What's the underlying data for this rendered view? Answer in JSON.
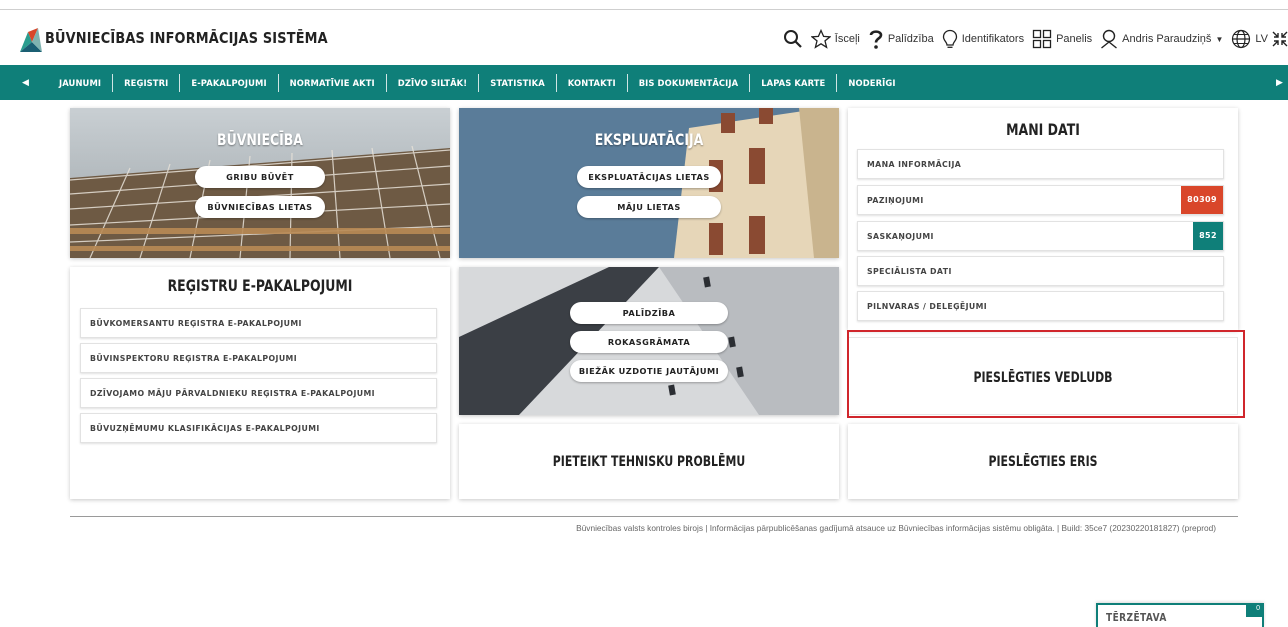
{
  "header": {
    "site_title": "BŪVNIECĪBAS INFORMĀCIJAS SISTĒMA",
    "tools": {
      "shortcuts": "Īsceļi",
      "help": "Palīdzība",
      "identifiers": "Identifikators",
      "panel": "Panelis",
      "user": "Andris Paraudziņš",
      "language": "LV"
    }
  },
  "nav": {
    "items": [
      "JAUNUMI",
      "REĢISTRI",
      "E-PAKALPOJUMI",
      "NORMATĪVIE AKTI",
      "DZĪVO SILTĀK!",
      "STATISTIKA",
      "KONTAKTI",
      "BIS DOKUMENTĀCIJA",
      "LAPAS KARTE",
      "NODERĪGI"
    ],
    "left_arrow": "◀",
    "right_arrow": "▶"
  },
  "buvnieciba": {
    "title": "BŪVNIECĪBA",
    "buttons": [
      "GRIBU BŪVĒT",
      "BŪVNIECĪBAS LIETAS"
    ]
  },
  "ekspluatacija": {
    "title": "EKSPLUATĀCIJA",
    "buttons": [
      "EKSPLUATĀCIJAS LIETAS",
      "MĀJU LIETAS"
    ]
  },
  "mani_dati": {
    "title": "MANI DATI",
    "items": [
      {
        "label": "MANA INFORMĀCIJA"
      },
      {
        "label": "PAZIŅOJUMI",
        "badge": "80309"
      },
      {
        "label": "SASKAŅOJUMI",
        "badge": "852"
      },
      {
        "label": "SPECIĀLISTA DATI"
      },
      {
        "label": "PILNVARAS / DELEĢĒJUMI"
      }
    ],
    "badge_colors": {
      "notifications": "#d9462a",
      "approvals": "#0f7f79"
    }
  },
  "registri": {
    "title": "REĢISTRU E-PAKALPOJUMI",
    "items": [
      "BŪVKOMERSANTU REĢISTRA E-PAKALPOJUMI",
      "BŪVINSPEKTORU REĢISTRA E-PAKALPOJUMI",
      "DZĪVOJAMO MĀJU PĀRVALDNIEKU REĢISTRA E-PAKALPOJUMI",
      "BŪVUZŅĒMUMU KLASIFIKĀCIJAS E-PAKALPOJUMI"
    ]
  },
  "support": {
    "buttons": [
      "PALĪDZĪBA",
      "ROKASGRĀMATA",
      "BIEŽĀK UZDOTIE JAUTĀJUMI"
    ]
  },
  "actions": {
    "vedludb": "PIESLĒGTIES VEDLUDB",
    "technical_problem": "PIETEIKT TEHNISKU PROBLĒMU",
    "eris": "PIESLĒGTIES ERIS"
  },
  "footer": {
    "text": "Būvniecības valsts kontroles birojs | Informācijas pārpublicēšanas gadījumā atsauce uz Būvniecības informācijas sistēmu obligāta. | Build: 35ce7 (20230220181827) (preprod)"
  },
  "chat": {
    "label": "TĒRZĒTAVA",
    "count": "0"
  },
  "colors": {
    "brand_teal": "#0f7f79",
    "highlight_red": "#d0262c",
    "badge_red": "#d9462a"
  }
}
